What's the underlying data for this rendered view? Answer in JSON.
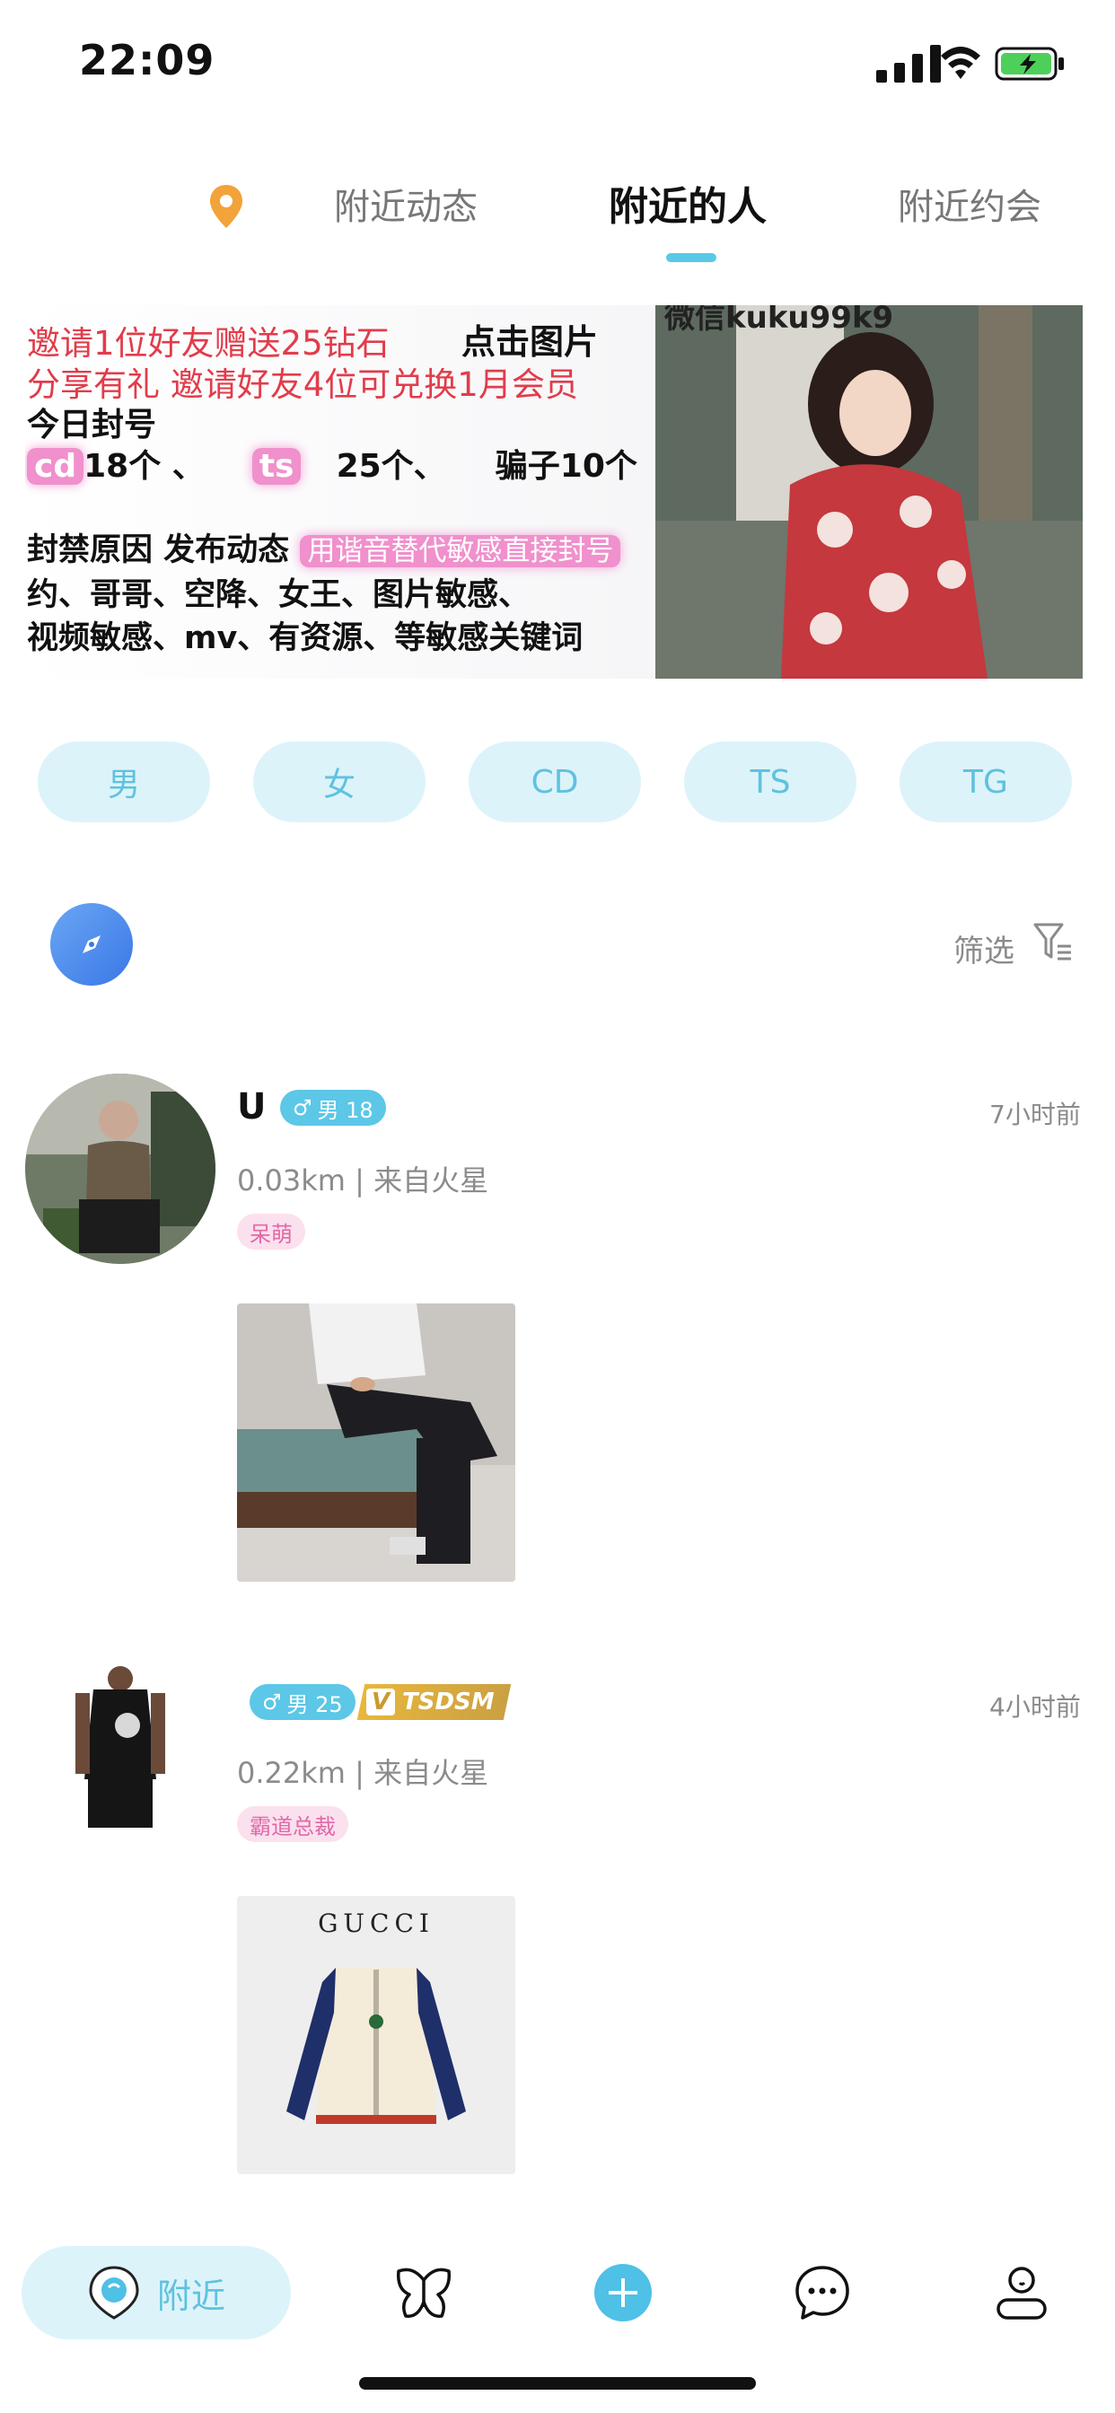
{
  "status_bar": {
    "time": "22:09"
  },
  "top_tabs": [
    {
      "label": "附近动态",
      "active": false
    },
    {
      "label": "附近的人",
      "active": true
    },
    {
      "label": "附近约会",
      "active": false
    }
  ],
  "banner": {
    "line1_a": "邀请1位好友赠送25钻石",
    "line1_b": "点击图片",
    "line2": "分享有礼 邀请好友4位可兑换1月会员",
    "line3": "今日封号",
    "line4_cd": "cd",
    "line4_cd_count": "18个 、",
    "line4_ts": "ts",
    "line4_ts_count": "25个、",
    "line4_scam": "骗子10个",
    "line5_a": "封禁原因 发布动态",
    "line5_b": "用谐音替代敏感直接封号",
    "line6": "约、哥哥、空降、女王、图片敏感、",
    "line7": "视频敏感、mv、有资源、等敏感关键词",
    "photo_caption": "微信kuku99k9"
  },
  "categories": [
    "男",
    "女",
    "CD",
    "TS",
    "TG"
  ],
  "filter": {
    "label": "筛选"
  },
  "posts": [
    {
      "username": "U",
      "gender_symbol": "♂",
      "gender_age": "男 18",
      "distance": "0.03km | 来自火星",
      "tag": "呆萌",
      "time": "7小时前"
    },
    {
      "username": "",
      "gender_symbol": "♂",
      "gender_age": "男 25",
      "vip_badge": "TSDSM",
      "vip_letter": "V",
      "distance": "0.22km | 来自火星",
      "tag": "霸道总裁",
      "time": "4小时前",
      "image_brand": "GUCCI"
    }
  ],
  "bottom_nav": {
    "active_label": "附近",
    "items": [
      "nearby",
      "butterfly",
      "add",
      "messages",
      "profile"
    ]
  },
  "colors": {
    "accent": "#5fc2de",
    "chip_bg": "#ddf3fa",
    "banner_red": "#e23c4a",
    "tag_pink": "#e069a8",
    "vip_gold": "#e8b73c",
    "pin_orange": "#f2a33a"
  }
}
